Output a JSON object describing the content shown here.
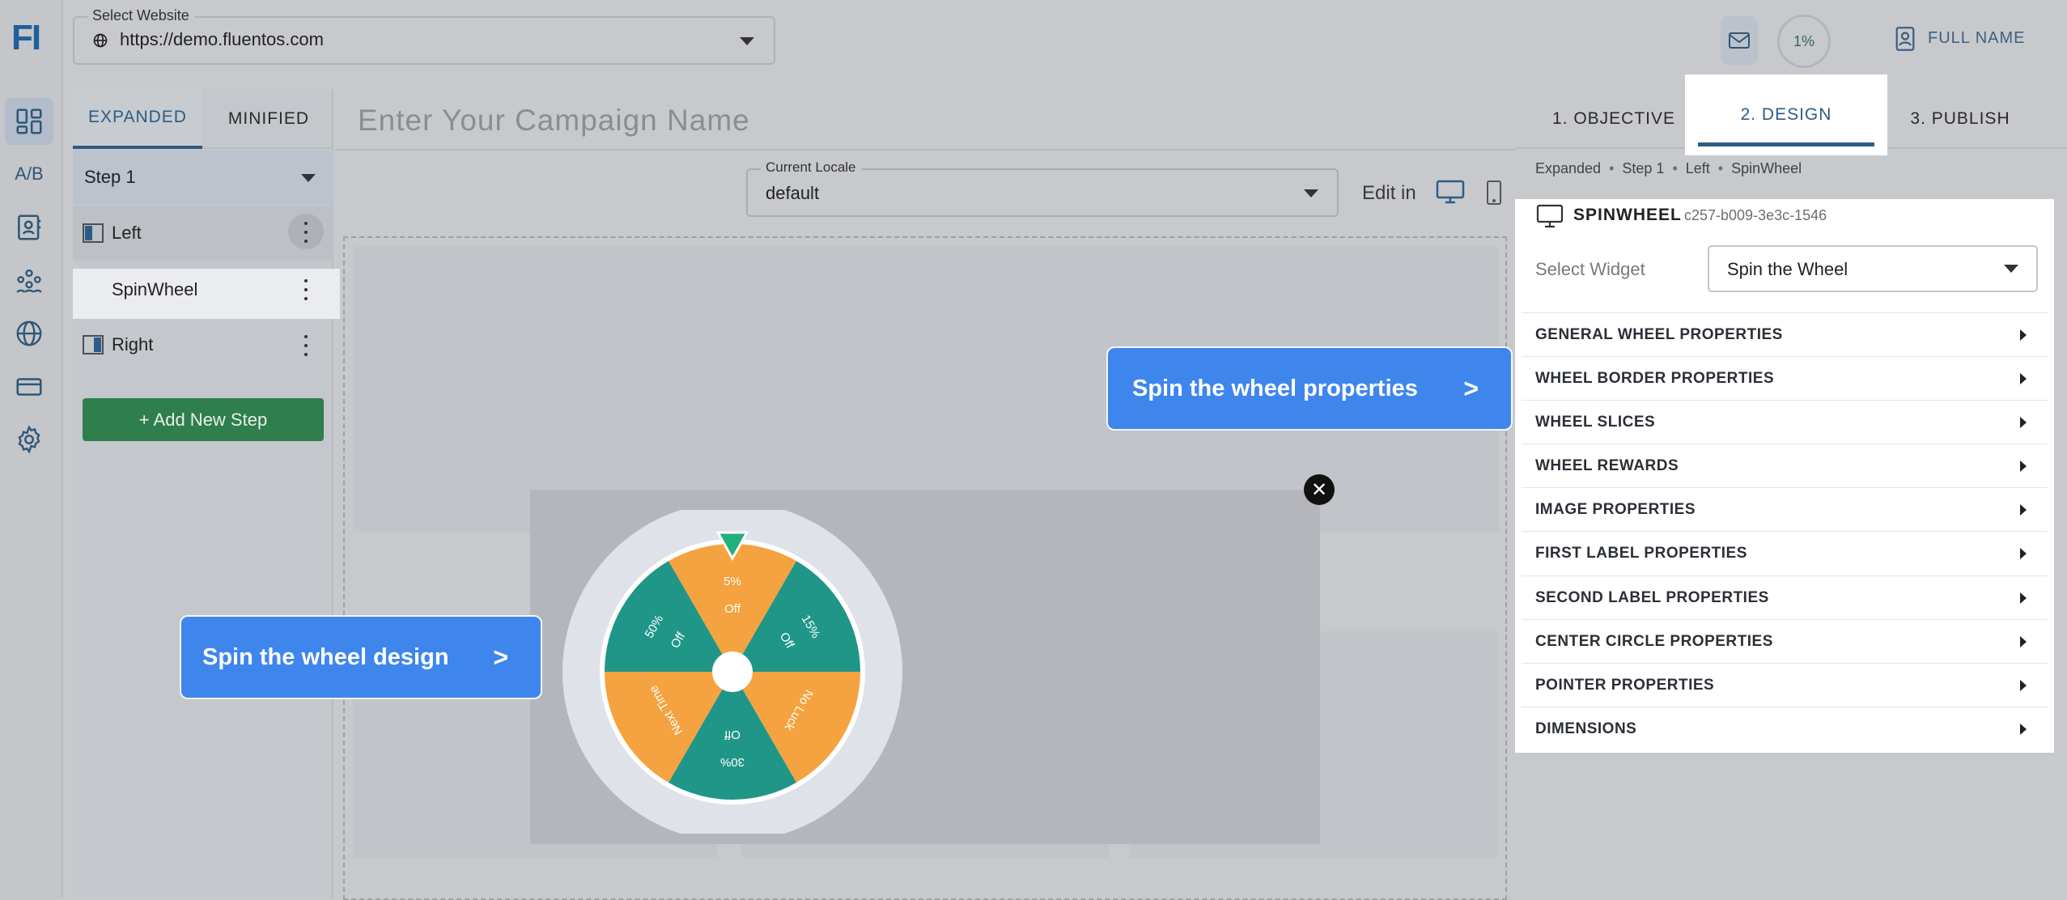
{
  "app": {
    "logo": "FI"
  },
  "rail": {
    "items": [
      {
        "name": "dashboard",
        "label": ""
      },
      {
        "name": "ab-test",
        "label": "A/B"
      },
      {
        "name": "contacts",
        "label": ""
      },
      {
        "name": "audience",
        "label": ""
      },
      {
        "name": "web",
        "label": ""
      },
      {
        "name": "billing",
        "label": ""
      },
      {
        "name": "settings",
        "label": ""
      }
    ]
  },
  "header": {
    "website_legend": "Select Website",
    "website_value": "https://demo.fluentos.com",
    "progress": "1%",
    "user_name": "FULL NAME"
  },
  "steps_panel": {
    "tabs": [
      "EXPANDED",
      "MINIFIED"
    ],
    "step_select": "Step 1",
    "tree": [
      "Left",
      "SpinWheel",
      "Right"
    ],
    "add_step": "+ Add New Step"
  },
  "canvas": {
    "campaign_placeholder": "Enter Your Campaign Name",
    "locale_legend": "Current Locale",
    "locale_value": "default",
    "edit_in": "Edit in"
  },
  "wheel": {
    "slices": [
      {
        "line1": "5%",
        "line2": "Off",
        "color": "#f4a340"
      },
      {
        "line1": "15%",
        "line2": "Off",
        "color": "#1f9688"
      },
      {
        "line1": "No Luck",
        "line2": "",
        "color": "#f4a340"
      },
      {
        "line1": "30%",
        "line2": "Off",
        "color": "#1f9688"
      },
      {
        "line1": "Next Time",
        "line2": "",
        "color": "#f4a340"
      },
      {
        "line1": "50%",
        "line2": "Off",
        "color": "#1f9688"
      }
    ],
    "pointer_color": "#22b07d",
    "border_color": "#dfe2e8"
  },
  "callouts": {
    "design": "Spin the wheel design",
    "design_arrow": ">",
    "properties": "Spin the wheel properties",
    "properties_arrow": ">"
  },
  "right_panel": {
    "tabs": [
      "1. OBJECTIVE",
      "2. DESIGN",
      "3. PUBLISH"
    ],
    "breadcrumb": [
      "Expanded",
      "Step 1",
      "Left",
      "SpinWheel"
    ],
    "widget_title": "SPINWHEEL",
    "widget_id": "c257-b009-3e3c-1546",
    "select_widget_label": "Select Widget",
    "select_widget_value": "Spin the Wheel",
    "sections": [
      "GENERAL WHEEL PROPERTIES",
      "WHEEL BORDER PROPERTIES",
      "WHEEL SLICES",
      "WHEEL REWARDS",
      "IMAGE PROPERTIES",
      "FIRST LABEL PROPERTIES",
      "SECOND LABEL PROPERTIES",
      "CENTER CIRCLE PROPERTIES",
      "POINTER PROPERTIES",
      "DIMENSIONS"
    ]
  },
  "colors": {
    "accent": "#2c5c86",
    "callout": "#3f86ec",
    "add_step": "#2f7e4e"
  }
}
